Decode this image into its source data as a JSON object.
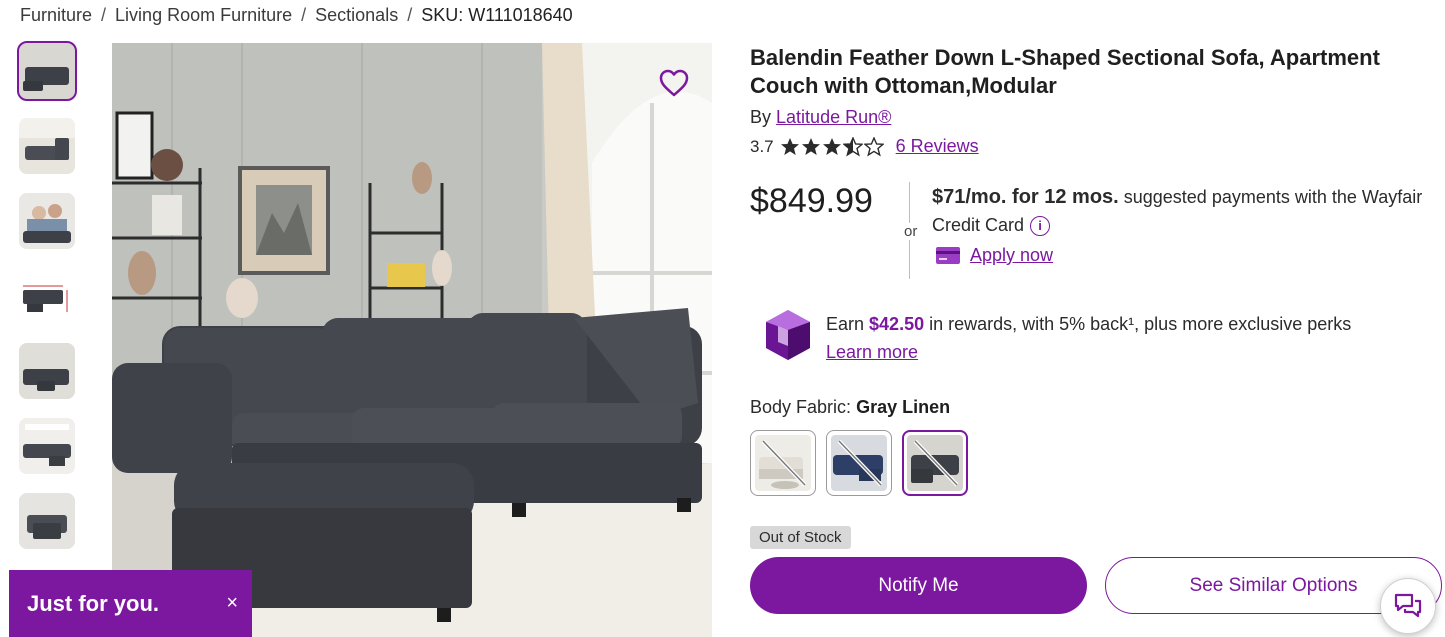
{
  "breadcrumb": {
    "items": [
      "Furniture",
      "Living Room Furniture",
      "Sectionals"
    ],
    "separator": "/",
    "sku": "SKU: W111018640"
  },
  "product": {
    "title": "Balendin Feather Down L-Shaped Sectional Sofa, Apartment Couch with Ottoman,Modular",
    "by_prefix": "By",
    "brand": "Latitude Run®",
    "rating": "3.7",
    "rating_value": 3.7,
    "reviews_link": "6 Reviews",
    "price": "$849.99"
  },
  "financing": {
    "or": "or",
    "monthly": "$71/mo. for 12 mos.",
    "suffix": " suggested payments with the Wayfair Credit Card",
    "info_icon": "info-icon",
    "apply": "Apply now"
  },
  "rewards": {
    "prefix": "Earn ",
    "amount": "$42.50",
    "suffix": " in rewards, with 5% back¹, plus more exclusive perks",
    "learn_more": "Learn more"
  },
  "options": {
    "label": "Body Fabric:",
    "selected": "Gray Linen"
  },
  "stock": "Out of Stock",
  "buttons": {
    "notify": "Notify Me",
    "similar": "See Similar Options"
  },
  "promo": {
    "text": "Just for you.",
    "close": "×"
  },
  "colors": {
    "accent": "#7b189f",
    "sofa": "#3d4046",
    "rewards_gem": "#8a2bb5"
  }
}
